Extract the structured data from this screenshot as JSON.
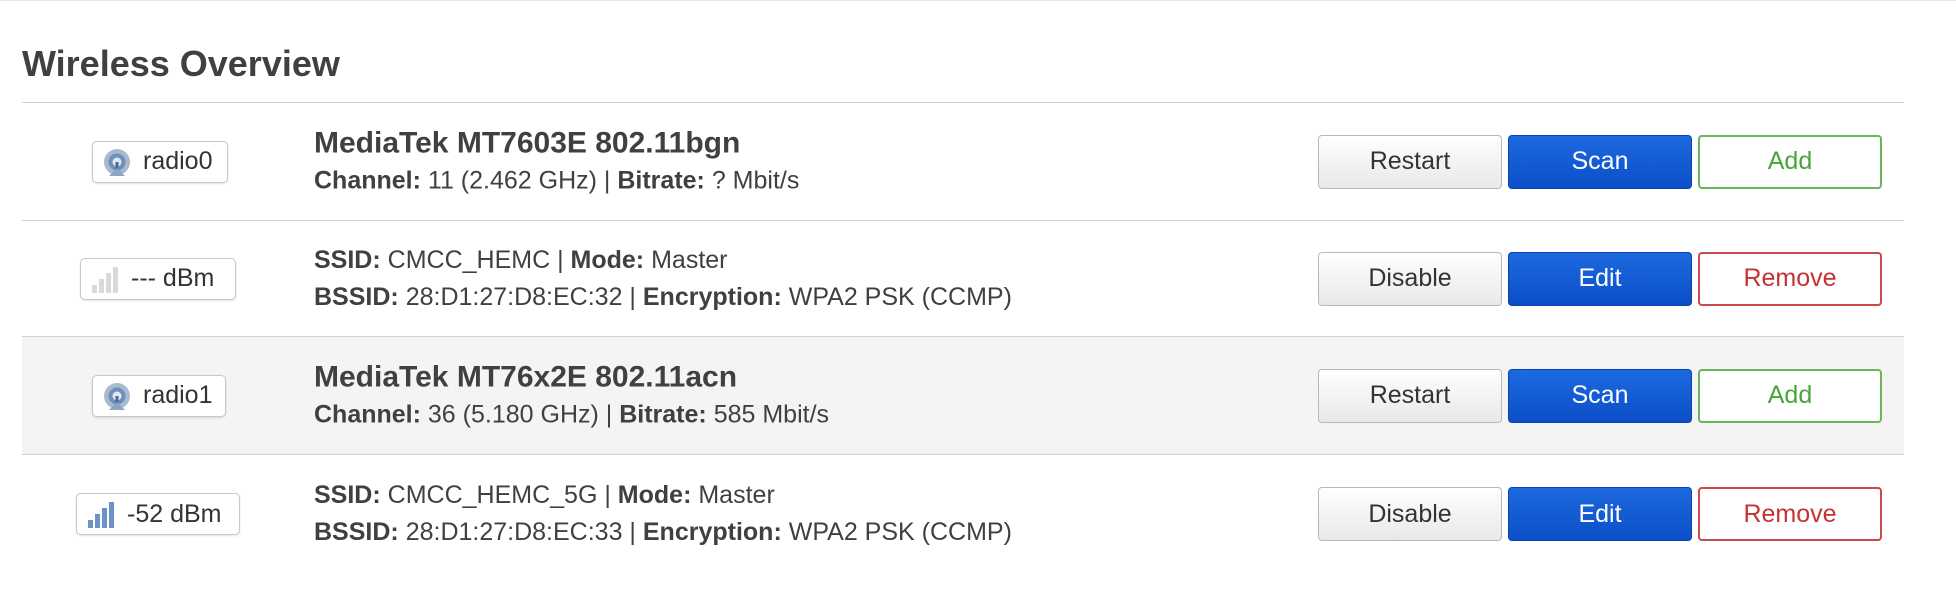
{
  "page": {
    "title": "Wireless Overview"
  },
  "colors": {
    "primary": "#0b4fc8",
    "positive": "#4aa33a",
    "negative": "#c23434",
    "alt_row": "#f4f4f4"
  },
  "rows": [
    {
      "type": "device",
      "badge": {
        "icon": "wifi-radio-icon",
        "label": "radio0"
      },
      "name": "MediaTek MT7603E 802.11bgn",
      "line1": [
        {
          "label": "Channel:",
          "value": "11 (2.462 GHz)"
        },
        {
          "label": "Bitrate:",
          "value": "? Mbit/s"
        }
      ],
      "buttons": [
        "Restart",
        "Scan",
        "Add"
      ]
    },
    {
      "type": "network",
      "badge": {
        "icon": "signal-empty-icon",
        "label": "--- dBm"
      },
      "line1": [
        {
          "label": "SSID:",
          "value": "CMCC_HEMC"
        },
        {
          "label": "Mode:",
          "value": "Master"
        }
      ],
      "line2": [
        {
          "label": "BSSID:",
          "value": "28:D1:27:D8:EC:32"
        },
        {
          "label": "Encryption:",
          "value": "WPA2 PSK (CCMP)"
        }
      ],
      "buttons": [
        "Disable",
        "Edit",
        "Remove"
      ]
    },
    {
      "type": "device",
      "badge": {
        "icon": "wifi-radio-icon",
        "label": "radio1"
      },
      "name": "MediaTek MT76x2E 802.11acn",
      "line1": [
        {
          "label": "Channel:",
          "value": "36 (5.180 GHz)"
        },
        {
          "label": "Bitrate:",
          "value": "585 Mbit/s"
        }
      ],
      "buttons": [
        "Restart",
        "Scan",
        "Add"
      ]
    },
    {
      "type": "network",
      "badge": {
        "icon": "signal-strong-icon",
        "label": "-52 dBm"
      },
      "line1": [
        {
          "label": "SSID:",
          "value": "CMCC_HEMC_5G"
        },
        {
          "label": "Mode:",
          "value": "Master"
        }
      ],
      "line2": [
        {
          "label": "BSSID:",
          "value": "28:D1:27:D8:EC:33"
        },
        {
          "label": "Encryption:",
          "value": "WPA2 PSK (CCMP)"
        }
      ],
      "buttons": [
        "Disable",
        "Edit",
        "Remove"
      ]
    }
  ]
}
